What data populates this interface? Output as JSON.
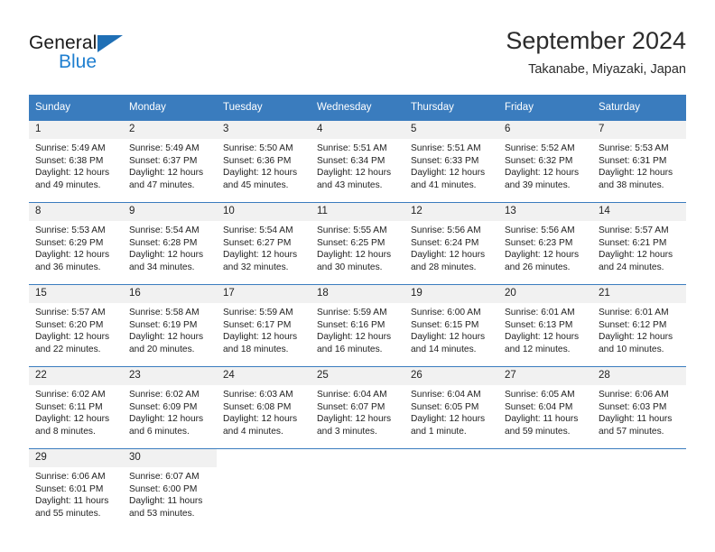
{
  "brand": {
    "line1": "General",
    "line2": "Blue",
    "triangle_color": "#1f6fb5",
    "blue_color": "#1f7fd0"
  },
  "header": {
    "title": "September 2024",
    "subtitle": "Takanabe, Miyazaki, Japan"
  },
  "theme": {
    "header_blue": "#3a7cbe",
    "daynum_bg": "#f1f1f1",
    "text": "#222222"
  },
  "weekday_headers": [
    "Sunday",
    "Monday",
    "Tuesday",
    "Wednesday",
    "Thursday",
    "Friday",
    "Saturday"
  ],
  "weeks": [
    [
      {
        "day": "1",
        "sunrise": "Sunrise: 5:49 AM",
        "sunset": "Sunset: 6:38 PM",
        "daylight1": "Daylight: 12 hours",
        "daylight2": "and 49 minutes."
      },
      {
        "day": "2",
        "sunrise": "Sunrise: 5:49 AM",
        "sunset": "Sunset: 6:37 PM",
        "daylight1": "Daylight: 12 hours",
        "daylight2": "and 47 minutes."
      },
      {
        "day": "3",
        "sunrise": "Sunrise: 5:50 AM",
        "sunset": "Sunset: 6:36 PM",
        "daylight1": "Daylight: 12 hours",
        "daylight2": "and 45 minutes."
      },
      {
        "day": "4",
        "sunrise": "Sunrise: 5:51 AM",
        "sunset": "Sunset: 6:34 PM",
        "daylight1": "Daylight: 12 hours",
        "daylight2": "and 43 minutes."
      },
      {
        "day": "5",
        "sunrise": "Sunrise: 5:51 AM",
        "sunset": "Sunset: 6:33 PM",
        "daylight1": "Daylight: 12 hours",
        "daylight2": "and 41 minutes."
      },
      {
        "day": "6",
        "sunrise": "Sunrise: 5:52 AM",
        "sunset": "Sunset: 6:32 PM",
        "daylight1": "Daylight: 12 hours",
        "daylight2": "and 39 minutes."
      },
      {
        "day": "7",
        "sunrise": "Sunrise: 5:53 AM",
        "sunset": "Sunset: 6:31 PM",
        "daylight1": "Daylight: 12 hours",
        "daylight2": "and 38 minutes."
      }
    ],
    [
      {
        "day": "8",
        "sunrise": "Sunrise: 5:53 AM",
        "sunset": "Sunset: 6:29 PM",
        "daylight1": "Daylight: 12 hours",
        "daylight2": "and 36 minutes."
      },
      {
        "day": "9",
        "sunrise": "Sunrise: 5:54 AM",
        "sunset": "Sunset: 6:28 PM",
        "daylight1": "Daylight: 12 hours",
        "daylight2": "and 34 minutes."
      },
      {
        "day": "10",
        "sunrise": "Sunrise: 5:54 AM",
        "sunset": "Sunset: 6:27 PM",
        "daylight1": "Daylight: 12 hours",
        "daylight2": "and 32 minutes."
      },
      {
        "day": "11",
        "sunrise": "Sunrise: 5:55 AM",
        "sunset": "Sunset: 6:25 PM",
        "daylight1": "Daylight: 12 hours",
        "daylight2": "and 30 minutes."
      },
      {
        "day": "12",
        "sunrise": "Sunrise: 5:56 AM",
        "sunset": "Sunset: 6:24 PM",
        "daylight1": "Daylight: 12 hours",
        "daylight2": "and 28 minutes."
      },
      {
        "day": "13",
        "sunrise": "Sunrise: 5:56 AM",
        "sunset": "Sunset: 6:23 PM",
        "daylight1": "Daylight: 12 hours",
        "daylight2": "and 26 minutes."
      },
      {
        "day": "14",
        "sunrise": "Sunrise: 5:57 AM",
        "sunset": "Sunset: 6:21 PM",
        "daylight1": "Daylight: 12 hours",
        "daylight2": "and 24 minutes."
      }
    ],
    [
      {
        "day": "15",
        "sunrise": "Sunrise: 5:57 AM",
        "sunset": "Sunset: 6:20 PM",
        "daylight1": "Daylight: 12 hours",
        "daylight2": "and 22 minutes."
      },
      {
        "day": "16",
        "sunrise": "Sunrise: 5:58 AM",
        "sunset": "Sunset: 6:19 PM",
        "daylight1": "Daylight: 12 hours",
        "daylight2": "and 20 minutes."
      },
      {
        "day": "17",
        "sunrise": "Sunrise: 5:59 AM",
        "sunset": "Sunset: 6:17 PM",
        "daylight1": "Daylight: 12 hours",
        "daylight2": "and 18 minutes."
      },
      {
        "day": "18",
        "sunrise": "Sunrise: 5:59 AM",
        "sunset": "Sunset: 6:16 PM",
        "daylight1": "Daylight: 12 hours",
        "daylight2": "and 16 minutes."
      },
      {
        "day": "19",
        "sunrise": "Sunrise: 6:00 AM",
        "sunset": "Sunset: 6:15 PM",
        "daylight1": "Daylight: 12 hours",
        "daylight2": "and 14 minutes."
      },
      {
        "day": "20",
        "sunrise": "Sunrise: 6:01 AM",
        "sunset": "Sunset: 6:13 PM",
        "daylight1": "Daylight: 12 hours",
        "daylight2": "and 12 minutes."
      },
      {
        "day": "21",
        "sunrise": "Sunrise: 6:01 AM",
        "sunset": "Sunset: 6:12 PM",
        "daylight1": "Daylight: 12 hours",
        "daylight2": "and 10 minutes."
      }
    ],
    [
      {
        "day": "22",
        "sunrise": "Sunrise: 6:02 AM",
        "sunset": "Sunset: 6:11 PM",
        "daylight1": "Daylight: 12 hours",
        "daylight2": "and 8 minutes."
      },
      {
        "day": "23",
        "sunrise": "Sunrise: 6:02 AM",
        "sunset": "Sunset: 6:09 PM",
        "daylight1": "Daylight: 12 hours",
        "daylight2": "and 6 minutes."
      },
      {
        "day": "24",
        "sunrise": "Sunrise: 6:03 AM",
        "sunset": "Sunset: 6:08 PM",
        "daylight1": "Daylight: 12 hours",
        "daylight2": "and 4 minutes."
      },
      {
        "day": "25",
        "sunrise": "Sunrise: 6:04 AM",
        "sunset": "Sunset: 6:07 PM",
        "daylight1": "Daylight: 12 hours",
        "daylight2": "and 3 minutes."
      },
      {
        "day": "26",
        "sunrise": "Sunrise: 6:04 AM",
        "sunset": "Sunset: 6:05 PM",
        "daylight1": "Daylight: 12 hours",
        "daylight2": "and 1 minute."
      },
      {
        "day": "27",
        "sunrise": "Sunrise: 6:05 AM",
        "sunset": "Sunset: 6:04 PM",
        "daylight1": "Daylight: 11 hours",
        "daylight2": "and 59 minutes."
      },
      {
        "day": "28",
        "sunrise": "Sunrise: 6:06 AM",
        "sunset": "Sunset: 6:03 PM",
        "daylight1": "Daylight: 11 hours",
        "daylight2": "and 57 minutes."
      }
    ],
    [
      {
        "day": "29",
        "sunrise": "Sunrise: 6:06 AM",
        "sunset": "Sunset: 6:01 PM",
        "daylight1": "Daylight: 11 hours",
        "daylight2": "and 55 minutes."
      },
      {
        "day": "30",
        "sunrise": "Sunrise: 6:07 AM",
        "sunset": "Sunset: 6:00 PM",
        "daylight1": "Daylight: 11 hours",
        "daylight2": "and 53 minutes."
      },
      {
        "day": "",
        "sunrise": "",
        "sunset": "",
        "daylight1": "",
        "daylight2": ""
      },
      {
        "day": "",
        "sunrise": "",
        "sunset": "",
        "daylight1": "",
        "daylight2": ""
      },
      {
        "day": "",
        "sunrise": "",
        "sunset": "",
        "daylight1": "",
        "daylight2": ""
      },
      {
        "day": "",
        "sunrise": "",
        "sunset": "",
        "daylight1": "",
        "daylight2": ""
      },
      {
        "day": "",
        "sunrise": "",
        "sunset": "",
        "daylight1": "",
        "daylight2": ""
      }
    ]
  ]
}
